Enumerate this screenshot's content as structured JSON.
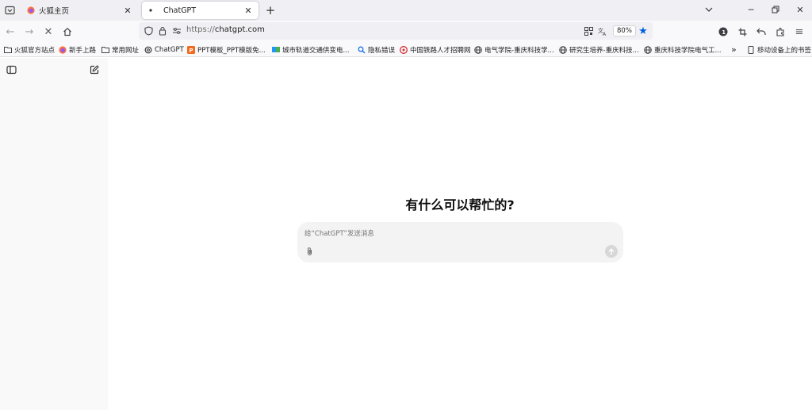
{
  "tabs": [
    {
      "label": "火狐主页",
      "active": false
    },
    {
      "label": "ChatGPT",
      "active": true
    }
  ],
  "address": {
    "scheme": "https://",
    "host": "chatgpt.com",
    "zoom": "80%"
  },
  "bookmarks": [
    {
      "label": "火狐官方站点",
      "icon": "folder-icon"
    },
    {
      "label": "新手上路",
      "icon": "firefox-icon"
    },
    {
      "label": "常用网址",
      "icon": "folder-icon"
    },
    {
      "label": "ChatGPT",
      "icon": "openai-icon"
    },
    {
      "label": "PPT模板_PPT模版免...",
      "icon": "ppt-icon"
    },
    {
      "label": "城市轨道交通供变电...",
      "icon": "map-icon"
    },
    {
      "label": "隐私错误",
      "icon": "search-icon"
    },
    {
      "label": "中国铁路人才招聘网",
      "icon": "railway-icon"
    },
    {
      "label": "电气学院-重庆科技学...",
      "icon": "globe-icon"
    },
    {
      "label": "研究生培养-重庆科技...",
      "icon": "globe-icon"
    },
    {
      "label": "重庆科技学院电气工...",
      "icon": "globe-icon"
    },
    {
      "label": "移动设备上的书签",
      "icon": "mobile-icon"
    }
  ],
  "main": {
    "headline": "有什么可以帮忙的?",
    "composer_placeholder": "给“ChatGPT”发送消息"
  },
  "colors": {
    "accent_blue": "#0060df",
    "tabstrip_bg": "#f0f0f4",
    "sidebar_bg": "#f9f9f9",
    "composer_bg": "#f3f3f3"
  }
}
